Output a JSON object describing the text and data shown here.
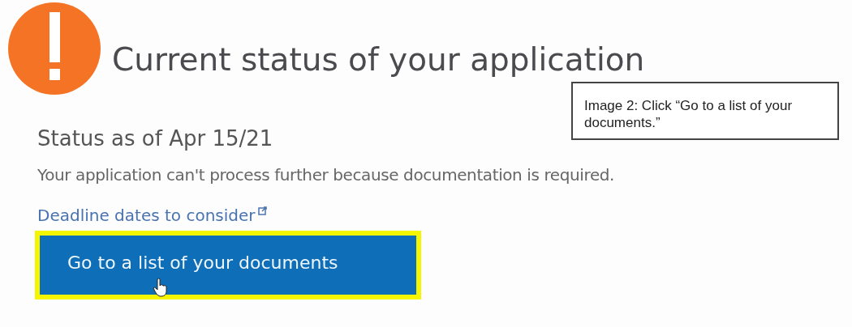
{
  "heading": "Current status of your application",
  "status_title": "Status as of Apr 15/21",
  "message": "Your application can't process further because documentation is required.",
  "link": {
    "label": "Deadline dates to consider",
    "external": true
  },
  "button": {
    "label": "Go to a list of your documents",
    "highlighted": true
  },
  "caption": "Image 2: Click “Go to a list of your documents.”"
}
